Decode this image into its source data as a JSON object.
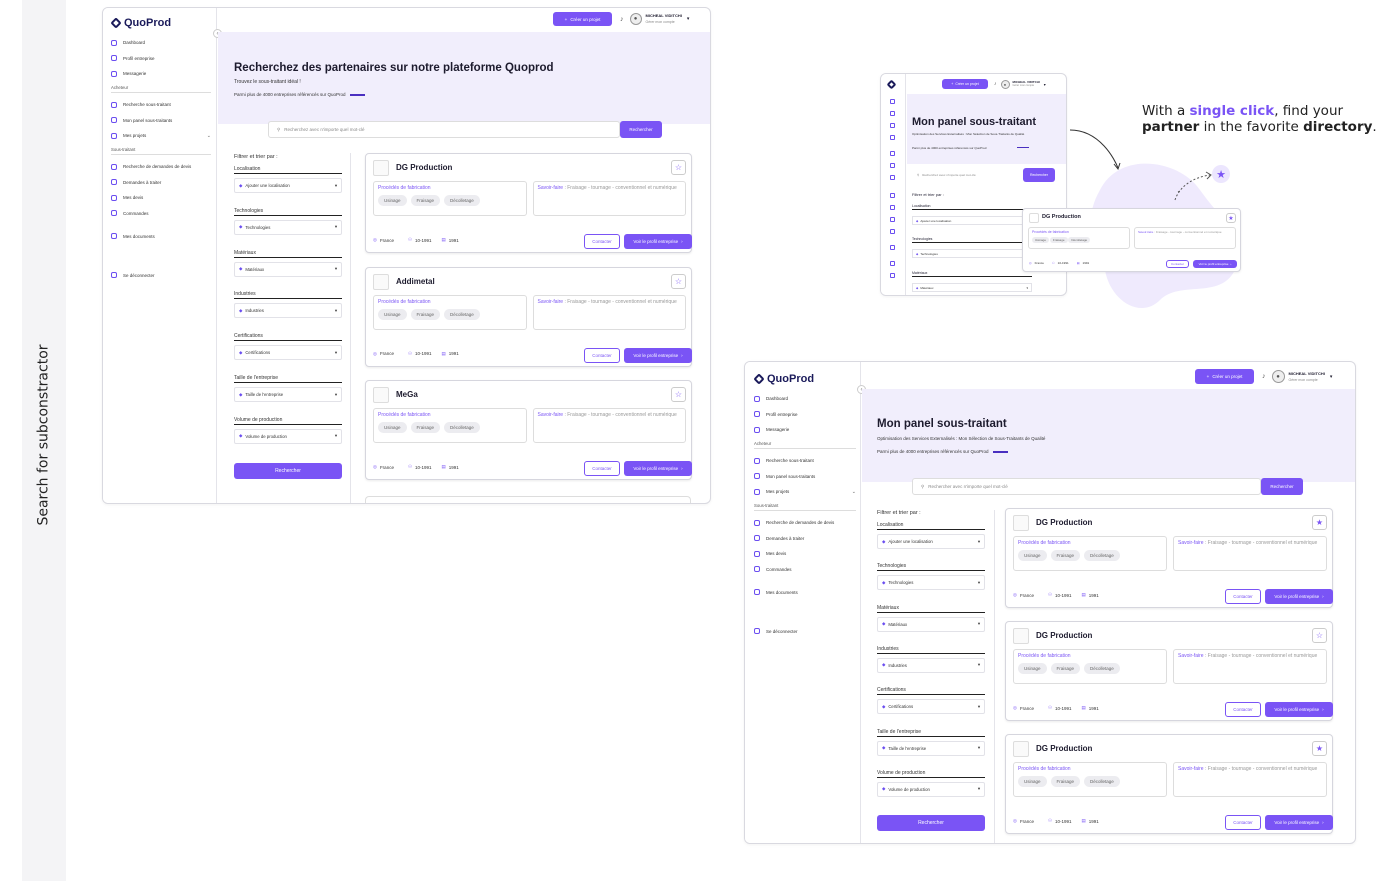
{
  "side_label": "Search for subconstractor",
  "brand": "QuoProd",
  "topbar": {
    "create_btn": "Créer un projet",
    "user_name": "MICHEAL VIDITCHI",
    "user_sub": "Gérer mon compte"
  },
  "sidebar": {
    "items_a": [
      "Dashboard",
      "Profil entreprise",
      "Messagerie"
    ],
    "section_1": "Acheteur",
    "items_b": [
      "Recherche sous-traitant",
      "Mon panel sous-traitants",
      "Mes projets"
    ],
    "section_2": "Sous-traitant",
    "items_c": [
      "Recherche de demandes de devis",
      "Demandes à traiter",
      "Mes devis",
      "Commandes"
    ],
    "documents": "Mes documents",
    "logout": "Se déconnecter"
  },
  "screen1": {
    "title": "Recherchez des partenaires sur notre plateforme Quoprod",
    "subtitle": "Trouvez le sous-traitant idéal !",
    "stat": "Parmi plus de 4000 entreprises référencés sur QuoProd",
    "search_placeholder": "Recherchez avec n'importe quel mot-clé",
    "search_btn": "Rechercher"
  },
  "screen3": {
    "title": "Mon panel sous-traitant",
    "subtitle": "Optimisation des Services Externalisés : Mon Sélection de Sous-Traitants de Qualité",
    "stat": "Parmi plus de 4000 entreprises référencés sur QuoProd",
    "search_placeholder": "Rechercher avec n'importe quel mot-clé",
    "search_btn": "Rechercher"
  },
  "screen2": {
    "title": "Mon panel sous-traitant",
    "subtitle": "Optimisation des Services Externalisés : Mon Sélection de Sous-Traitants de Qualité",
    "stat": "Parmi plus de 4000 entreprises référencés sur QuoProd",
    "search_placeholder": "Recherchez avec n'importe quel mot-clé",
    "search_btn": "Rechercher"
  },
  "filters": {
    "heading": "Filtrer et trier par :",
    "groups": [
      {
        "label": "Localisation",
        "value": "Ajouter une localisation"
      },
      {
        "label": "Technologies",
        "value": "Technologies"
      },
      {
        "label": "Matériaux",
        "value": "Matériaux"
      },
      {
        "label": "Industries",
        "value": "Industries"
      },
      {
        "label": "Certifications",
        "value": "Certifications"
      },
      {
        "label": "Taille de l'entreprise",
        "value": "Taille de l'entreprise"
      },
      {
        "label": "Volume de production",
        "value": "Volume de production"
      }
    ],
    "submit": "Rechercher"
  },
  "card_labels": {
    "process": "Procédés de fabrication",
    "savoir": "Savoir-faire",
    "savoir_text": " : Fraisage - tournage - conventionnel et numérique",
    "tags": [
      "Usinage",
      "Fraisage",
      "Décolletage"
    ],
    "contact": "Contacter",
    "profile": "Voir le profil entreprise"
  },
  "cards1": [
    {
      "name": "DG Production",
      "country": "France",
      "staff": "10-1991",
      "year": "1991"
    },
    {
      "name": "Addimetal",
      "country": "France",
      "staff": "10-1991",
      "year": "1991"
    },
    {
      "name": "MeGa",
      "country": "France",
      "staff": "10-1991",
      "year": "1991"
    }
  ],
  "cards3": [
    {
      "name": "DG Production",
      "country": "France",
      "staff": "10-1991",
      "year": "1991",
      "fav": "★"
    },
    {
      "name": "DG Production",
      "country": "France",
      "staff": "10-1991",
      "year": "1991",
      "fav": "☆"
    },
    {
      "name": "DG Production",
      "country": "France",
      "staff": "10-1991",
      "year": "1991",
      "fav": "★"
    }
  ],
  "popup_card": {
    "name": "DG Production",
    "country": "France",
    "staff": "10-1991",
    "year": "1991"
  },
  "caption": {
    "l1a": "With a ",
    "l1b": "single click",
    "l1c": ", find your",
    "l2a": "partner",
    "l2b": " in the favorite ",
    "l2c": "directory",
    "l2d": "."
  },
  "colors": {
    "accent": "#7a54f5",
    "hero_bg": "#f1eefc",
    "brand_dark": "#1a1a5a"
  }
}
